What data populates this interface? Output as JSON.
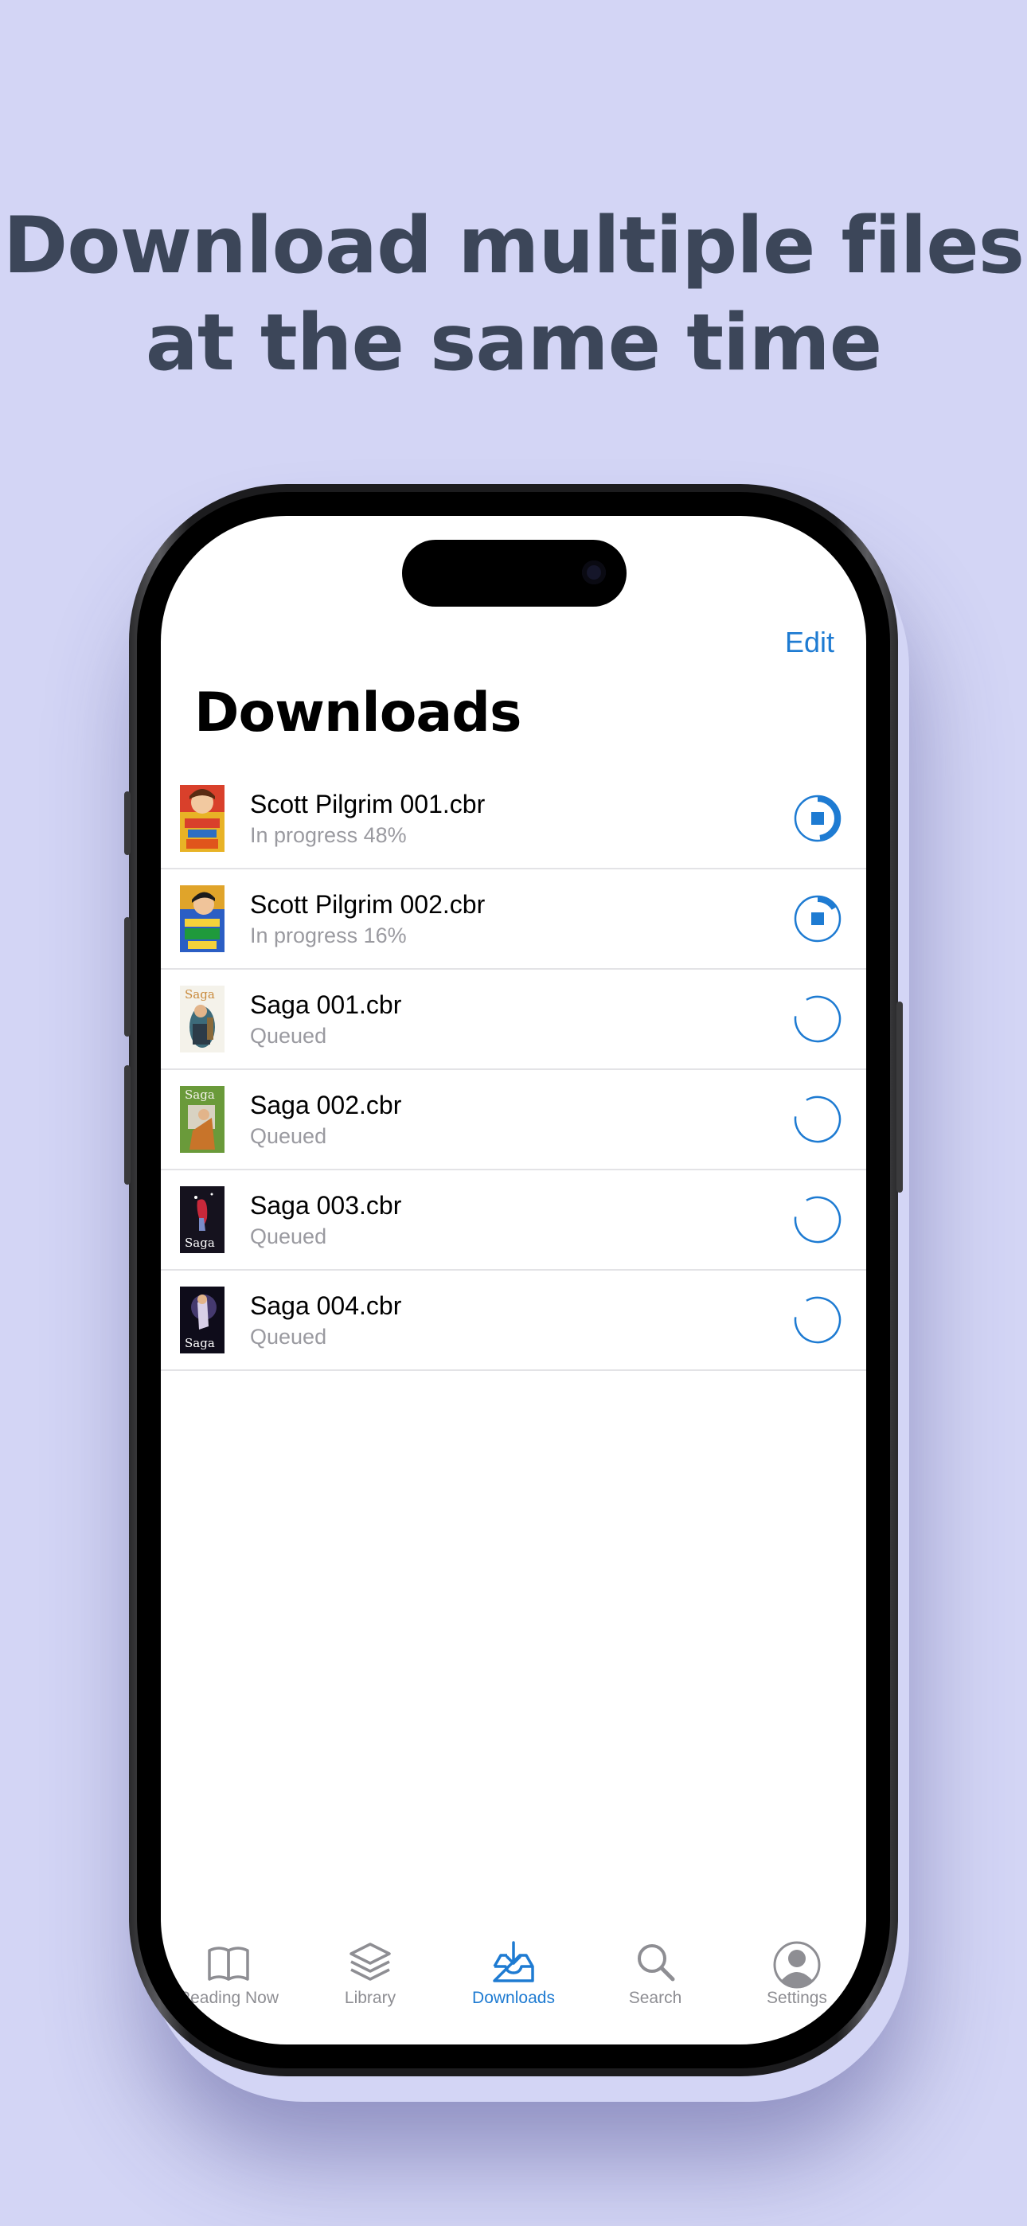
{
  "headline": {
    "line1": "Download multiple files",
    "line2": "at the same time"
  },
  "nav": {
    "edit_label": "Edit",
    "title": "Downloads"
  },
  "downloads": [
    {
      "name": "Scott Pilgrim 001.cbr",
      "status": "In progress 48%",
      "progress": 0.48,
      "state": "in-progress"
    },
    {
      "name": "Scott Pilgrim 002.cbr",
      "status": "In progress 16%",
      "progress": 0.16,
      "state": "in-progress"
    },
    {
      "name": "Saga 001.cbr",
      "status": "Queued",
      "progress": 0,
      "state": "queued"
    },
    {
      "name": "Saga 002.cbr",
      "status": "Queued",
      "progress": 0,
      "state": "queued"
    },
    {
      "name": "Saga 003.cbr",
      "status": "Queued",
      "progress": 0,
      "state": "queued"
    },
    {
      "name": "Saga 004.cbr",
      "status": "Queued",
      "progress": 0,
      "state": "queued"
    }
  ],
  "covers": {
    "saga_logo": "Saga"
  },
  "tabbar": {
    "tabs": [
      {
        "label": "Reading Now",
        "icon": "book-icon"
      },
      {
        "label": "Library",
        "icon": "layers-icon"
      },
      {
        "label": "Downloads",
        "icon": "tray-download-icon",
        "active": true
      },
      {
        "label": "Search",
        "icon": "search-icon"
      },
      {
        "label": "Settings",
        "icon": "person-icon"
      }
    ]
  },
  "colors": {
    "accent": "#1E7BD2",
    "background": "#D3D5F5",
    "headline": "#3C4659",
    "secondary_text": "#9A9AA0"
  }
}
